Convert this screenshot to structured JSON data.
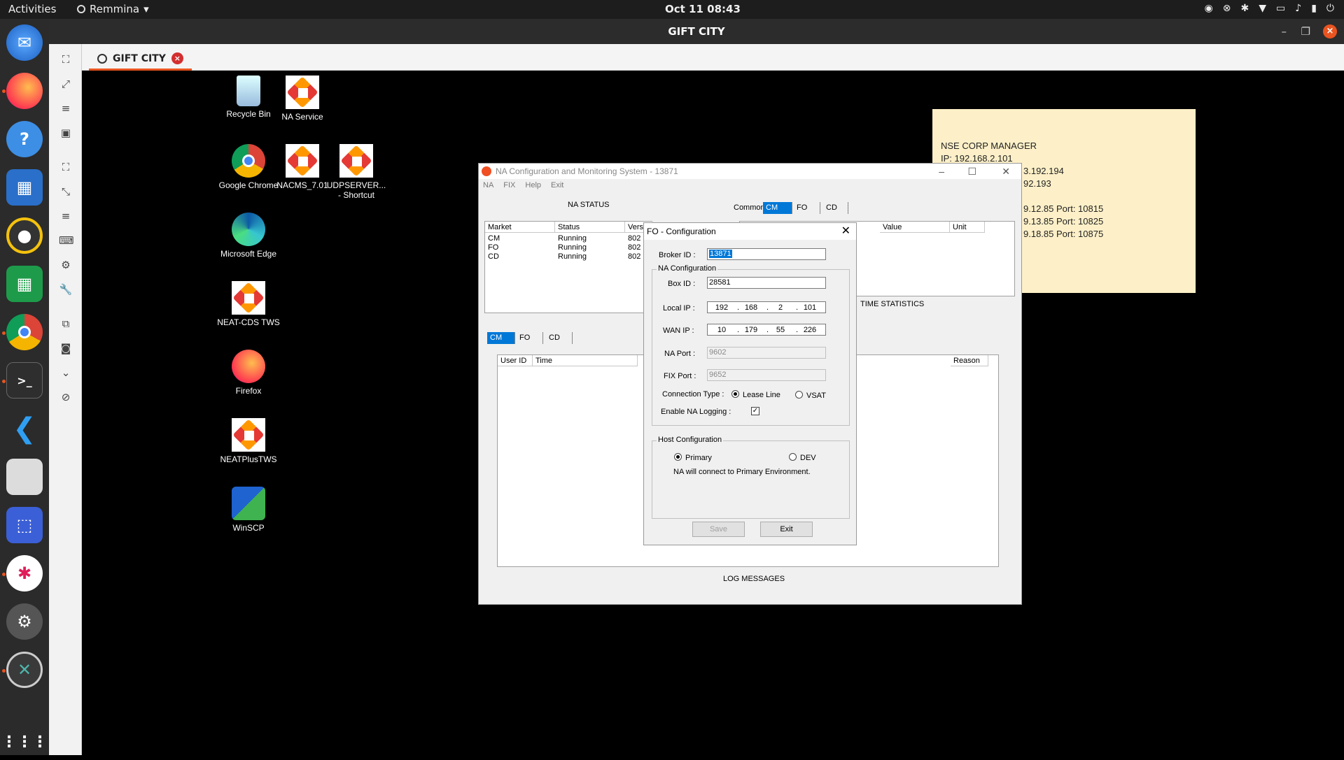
{
  "topbar": {
    "activities": "Activities",
    "app_menu": "Remmina",
    "clock": "Oct 11  08:43",
    "tray": [
      "chrome-icon",
      "remmina-icon",
      "slack-icon",
      "wifi-icon",
      "vpn-icon",
      "volume-icon",
      "battery-icon",
      "power-icon"
    ]
  },
  "dock": {
    "items": [
      "thunderbird",
      "firefox",
      "help",
      "libreoffice-impress",
      "rhythmbox",
      "libreoffice-calc",
      "chrome",
      "terminal",
      "vscode",
      "files",
      "screenshot",
      "slack",
      "settings",
      "remmina",
      "show-apps"
    ]
  },
  "remmina": {
    "window_title": "GIFT CITY",
    "tab_label": "GIFT CITY",
    "colors": {
      "accent": "#e95420"
    }
  },
  "desktop": {
    "icons": [
      {
        "label": "Recycle Bin"
      },
      {
        "label": "NA Service"
      },
      {
        "label": "Google Chrome"
      },
      {
        "label": "NACMS_7.01"
      },
      {
        "label": "UDPSERVER... - Shortcut"
      },
      {
        "label": "Microsoft Edge"
      },
      {
        "label": "NEAT-CDS TWS"
      },
      {
        "label": "Firefox"
      },
      {
        "label": "NEATPlusTWS"
      },
      {
        "label": "WinSCP"
      }
    ],
    "sticky": {
      "line1": "NSE CORP MANAGER",
      "line2": "IP: 192.168.2.101",
      "line3": "3.192.194",
      "line4": "92.193",
      "line5": "9.12.85 Port: 10815",
      "line6": "9.13.85 Port: 10825",
      "line7": "9.18.85 Port: 10875"
    }
  },
  "na_window": {
    "title": "NA Configuration and Monitoring System - 13871",
    "menu": [
      "NA",
      "FIX",
      "Help",
      "Exit"
    ],
    "status_heading": "NA STATUS",
    "status_headers": [
      "Market",
      "Status",
      "Vers"
    ],
    "status_rows": [
      {
        "market": "CM",
        "status": "Running",
        "ver": "802"
      },
      {
        "market": "FO",
        "status": "Running",
        "ver": "802"
      },
      {
        "market": "CD",
        "status": "Running",
        "ver": "802"
      }
    ],
    "right_tabs": [
      "Common",
      "CM",
      "FO",
      "CD"
    ],
    "right_active_tab": "CM",
    "right_headers": {
      "value": "Value",
      "unit": "Unit"
    },
    "time_stats": "TIME STATISTICS",
    "log_tabs": [
      "CM",
      "FO",
      "CD"
    ],
    "log_active_tab": "CM",
    "log_headers": {
      "user": "User ID",
      "time": "Time",
      "reason": "Reason"
    },
    "log_messages": "LOG MESSAGES"
  },
  "fo_dialog": {
    "title": "FO - Configuration",
    "broker_label": "Broker ID :",
    "broker_value": "13871",
    "na_group": "NA Configuration",
    "box_label": "Box ID :",
    "box_value": "28581",
    "local_ip_label": "Local IP :",
    "local_ip": [
      "192",
      "168",
      "2",
      "101"
    ],
    "wan_ip_label": "WAN IP :",
    "wan_ip": [
      "10",
      "179",
      "55",
      "226"
    ],
    "na_port_label": "NA Port :",
    "na_port_value": "9602",
    "fix_port_label": "FIX  Port :",
    "fix_port_value": "9652",
    "conn_type_label": "Connection Type :",
    "lease_line": "Lease Line",
    "vsat": "VSAT",
    "logging_label": "Enable NA Logging  :",
    "logging_checked": true,
    "host_group": "Host Configuration",
    "primary": "Primary",
    "dev": "DEV",
    "host_note": "NA will connect to Primary Environment.",
    "save_label": "Save",
    "exit_label": "Exit"
  }
}
